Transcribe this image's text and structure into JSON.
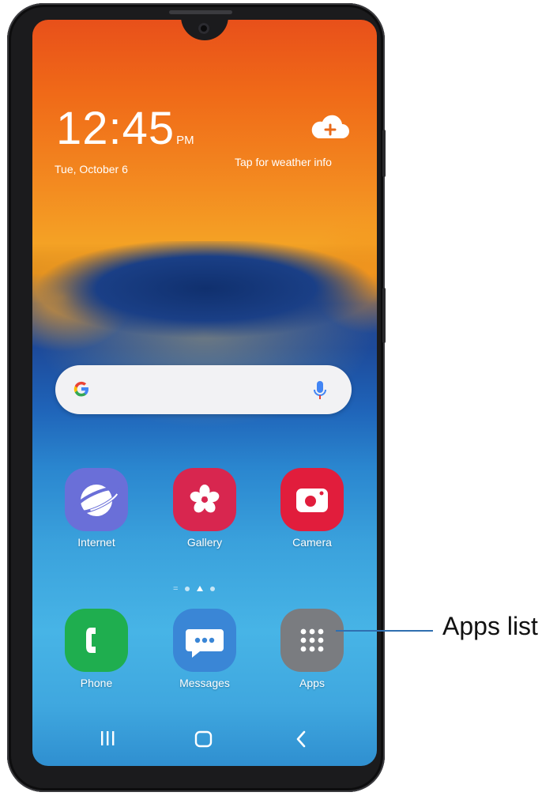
{
  "lock": {
    "time": "12:45",
    "ampm": "PM",
    "date": "Tue, October 6",
    "weather_text": "Tap for weather info"
  },
  "search": {
    "google_icon": "google-g-icon",
    "mic_icon": "microphone-icon"
  },
  "apps_row1": [
    {
      "label": "Internet",
      "icon": "internet-planet-icon",
      "color": "#6a6fd8"
    },
    {
      "label": "Gallery",
      "icon": "gallery-flower-icon",
      "color": "#d8264f"
    },
    {
      "label": "Camera",
      "icon": "camera-icon",
      "color": "#e11d3c"
    }
  ],
  "apps_row2": [
    {
      "label": "Phone",
      "icon": "phone-icon",
      "color": "#1fae4f"
    },
    {
      "label": "Messages",
      "icon": "messages-bubble-icon",
      "color": "#3a86d6"
    },
    {
      "label": "Apps",
      "icon": "apps-grid-icon",
      "color": "#7a7c80"
    }
  ],
  "nav": {
    "recents_icon": "recents-icon",
    "home_icon": "home-icon",
    "back_icon": "back-icon"
  },
  "callout": {
    "label": "Apps list"
  }
}
